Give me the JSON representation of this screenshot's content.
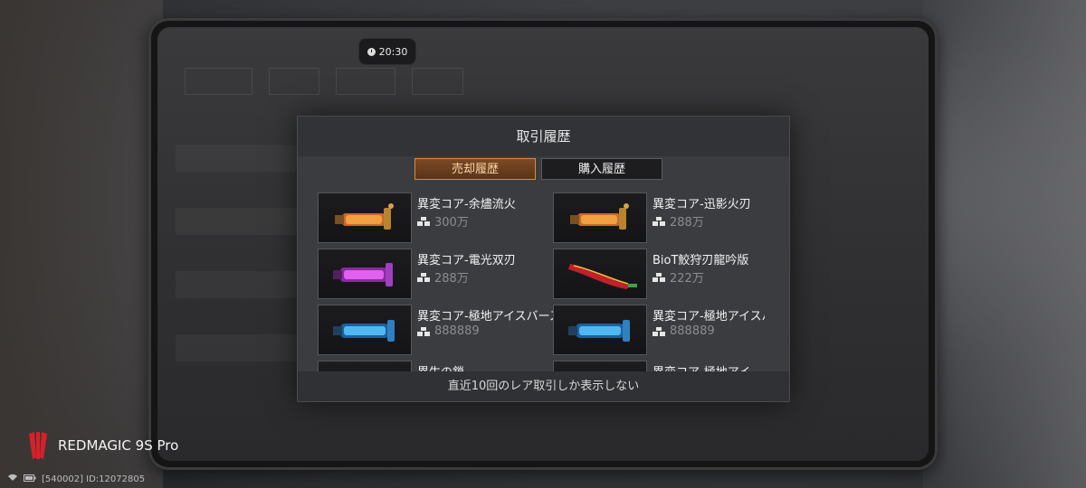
{
  "clock": {
    "time": "20:30"
  },
  "dialog": {
    "title": "取引履歴",
    "tabs": [
      {
        "label": "売却履歴",
        "active": true
      },
      {
        "label": "購入履歴",
        "active": false
      }
    ],
    "items": [
      {
        "name": "異変コア-余燼流火",
        "price": "300万",
        "icon": "orange-cannon-icon"
      },
      {
        "name": "異変コア-迅影火刃",
        "price": "288万",
        "icon": "orange-cannon-icon"
      },
      {
        "name": "異変コア-電光双刃",
        "price": "288万",
        "icon": "purple-cannon-icon"
      },
      {
        "name": "BioT鮫狩刃龍吟版",
        "price": "222万",
        "icon": "red-blade-icon"
      },
      {
        "name": "異変コア-極地アイスバースト",
        "price": "888889",
        "icon": "blue-cannon-icon"
      },
      {
        "name": "異変コア-極地アイスバースト",
        "price": "888889",
        "icon": "blue-cannon-icon"
      },
      {
        "name": "異生の鎖",
        "price": "",
        "icon": "item-icon"
      },
      {
        "name": "異変コア-極地アイ",
        "price": "",
        "icon": "item-icon"
      }
    ],
    "footer": "直近10回のレア取引しか表示しない"
  },
  "brand": {
    "name": "REDMAGIC 9S Pro"
  },
  "status": {
    "text": "[540002] ID:12072805"
  },
  "colors": {
    "active_tab_border": "#d98c42",
    "price_text": "#8b8c90"
  }
}
